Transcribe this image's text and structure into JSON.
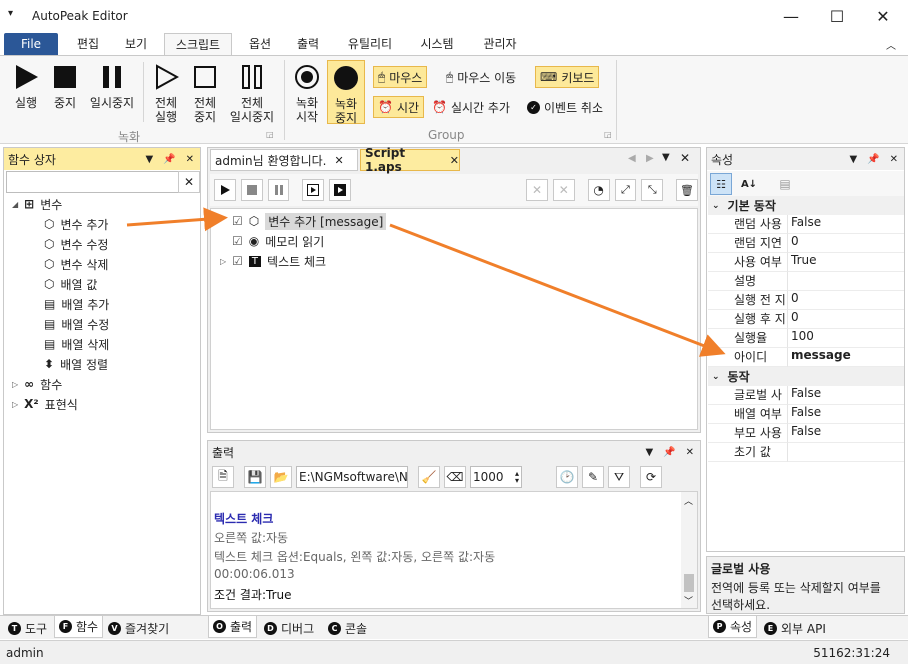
{
  "app": {
    "title": "AutoPeak Editor"
  },
  "menu": {
    "tabs": [
      "File",
      "편집",
      "보기",
      "스크립트",
      "옵션",
      "출력",
      "유틸리티",
      "시스템",
      "관리자"
    ]
  },
  "ribbon": {
    "recording_group": "녹화",
    "group2": "Group",
    "run": "실행",
    "stop": "중지",
    "pause": "일시중지",
    "all_run_1": "전체",
    "all_run_2": "실행",
    "all_stop_1": "전체",
    "all_stop_2": "중지",
    "all_pause_1": "전체",
    "all_pause_2": "일시중지",
    "rec_start_1": "녹화",
    "rec_start_2": "시작",
    "rec_stop_1": "녹화",
    "rec_stop_2": "중지",
    "mouse": "마우스",
    "mouse_move": "마우스 이동",
    "keyboard": "키보드",
    "time": "시간",
    "realtime_add": "실시간 추가",
    "event_cancel": "이벤트 취소"
  },
  "func_panel": {
    "title": "함수 상자",
    "search_value": "",
    "tree": [
      {
        "label": "변수",
        "level": 0,
        "icon": "variable-icon"
      },
      {
        "label": "변수 추가",
        "level": 1,
        "icon": "cube-icon"
      },
      {
        "label": "변수 수정",
        "level": 1,
        "icon": "cube-icon"
      },
      {
        "label": "변수 삭제",
        "level": 1,
        "icon": "cube-icon"
      },
      {
        "label": "배열 값",
        "level": 1,
        "icon": "cube-icon"
      },
      {
        "label": "배열 추가",
        "level": 1,
        "icon": "array-add-icon"
      },
      {
        "label": "배열 수정",
        "level": 1,
        "icon": "array-edit-icon"
      },
      {
        "label": "배열 삭제",
        "level": 1,
        "icon": "array-delete-icon"
      },
      {
        "label": "배열 정렬",
        "level": 1,
        "icon": "sort-icon"
      },
      {
        "label": "함수",
        "level": 0,
        "icon": "infinity-icon"
      },
      {
        "label": "표현식",
        "level": 0,
        "icon": "x-squared-icon"
      }
    ],
    "bottom_tabs": [
      "도구",
      "함수",
      "즐겨찾기"
    ]
  },
  "editor": {
    "tabs": [
      "admin님 환영합니다.",
      "Script 1.aps"
    ],
    "script_items": [
      {
        "label": "변수 추가 [message]",
        "icon": "cube-icon"
      },
      {
        "label": "메모리 읽기",
        "icon": "memory-icon"
      },
      {
        "label": "텍스트 체크",
        "icon": "text-icon"
      }
    ]
  },
  "output": {
    "title": "출력",
    "path": "E:\\NGMsoftware\\NG",
    "count": "1000",
    "lines": [
      {
        "text": "텍스트 체크",
        "style": "heading"
      },
      {
        "text": "오른쪽 값:자동",
        "style": "muted"
      },
      {
        "text": "텍스트 체크 옵션:Equals, 왼쪽 값:자동, 오른쪽 값:자동",
        "style": "muted"
      },
      {
        "text": "00:00:06.013",
        "style": "muted"
      },
      {
        "text": "조건 결과:True",
        "style": "normal"
      }
    ],
    "bottom_tabs": [
      "출력",
      "디버그",
      "콘솔"
    ]
  },
  "props": {
    "title": "속성",
    "cat1": "기본 동작",
    "rows1": [
      {
        "k": "랜덤 사용",
        "v": "False"
      },
      {
        "k": "랜덤 지연",
        "v": "0"
      },
      {
        "k": "사용 여부",
        "v": "True"
      },
      {
        "k": "설명",
        "v": ""
      },
      {
        "k": "실행 전 지",
        "v": "0"
      },
      {
        "k": "실행 후 지",
        "v": "0"
      },
      {
        "k": "실행율",
        "v": "100"
      },
      {
        "k": "아이디",
        "v": "message"
      }
    ],
    "cat2": "동작",
    "rows2": [
      {
        "k": "글로벌 사",
        "v": "False"
      },
      {
        "k": "배열 여부",
        "v": "False"
      },
      {
        "k": "부모 사용",
        "v": "False"
      },
      {
        "k": "초기 값",
        "v": ""
      }
    ],
    "desc_title": "글로벌 사용",
    "desc_line1": "전역에 등록 또는 삭제할지 여부를",
    "desc_line2": "선택하세요.",
    "bottom_tabs": [
      "속성",
      "외부 API"
    ]
  },
  "status": {
    "user": "admin",
    "time": "51162:31:24"
  },
  "colors": {
    "accent": "#2b5797",
    "highlight": "#fde99a",
    "panel_header": "#fdeca0",
    "arrow": "#f07f2a"
  }
}
